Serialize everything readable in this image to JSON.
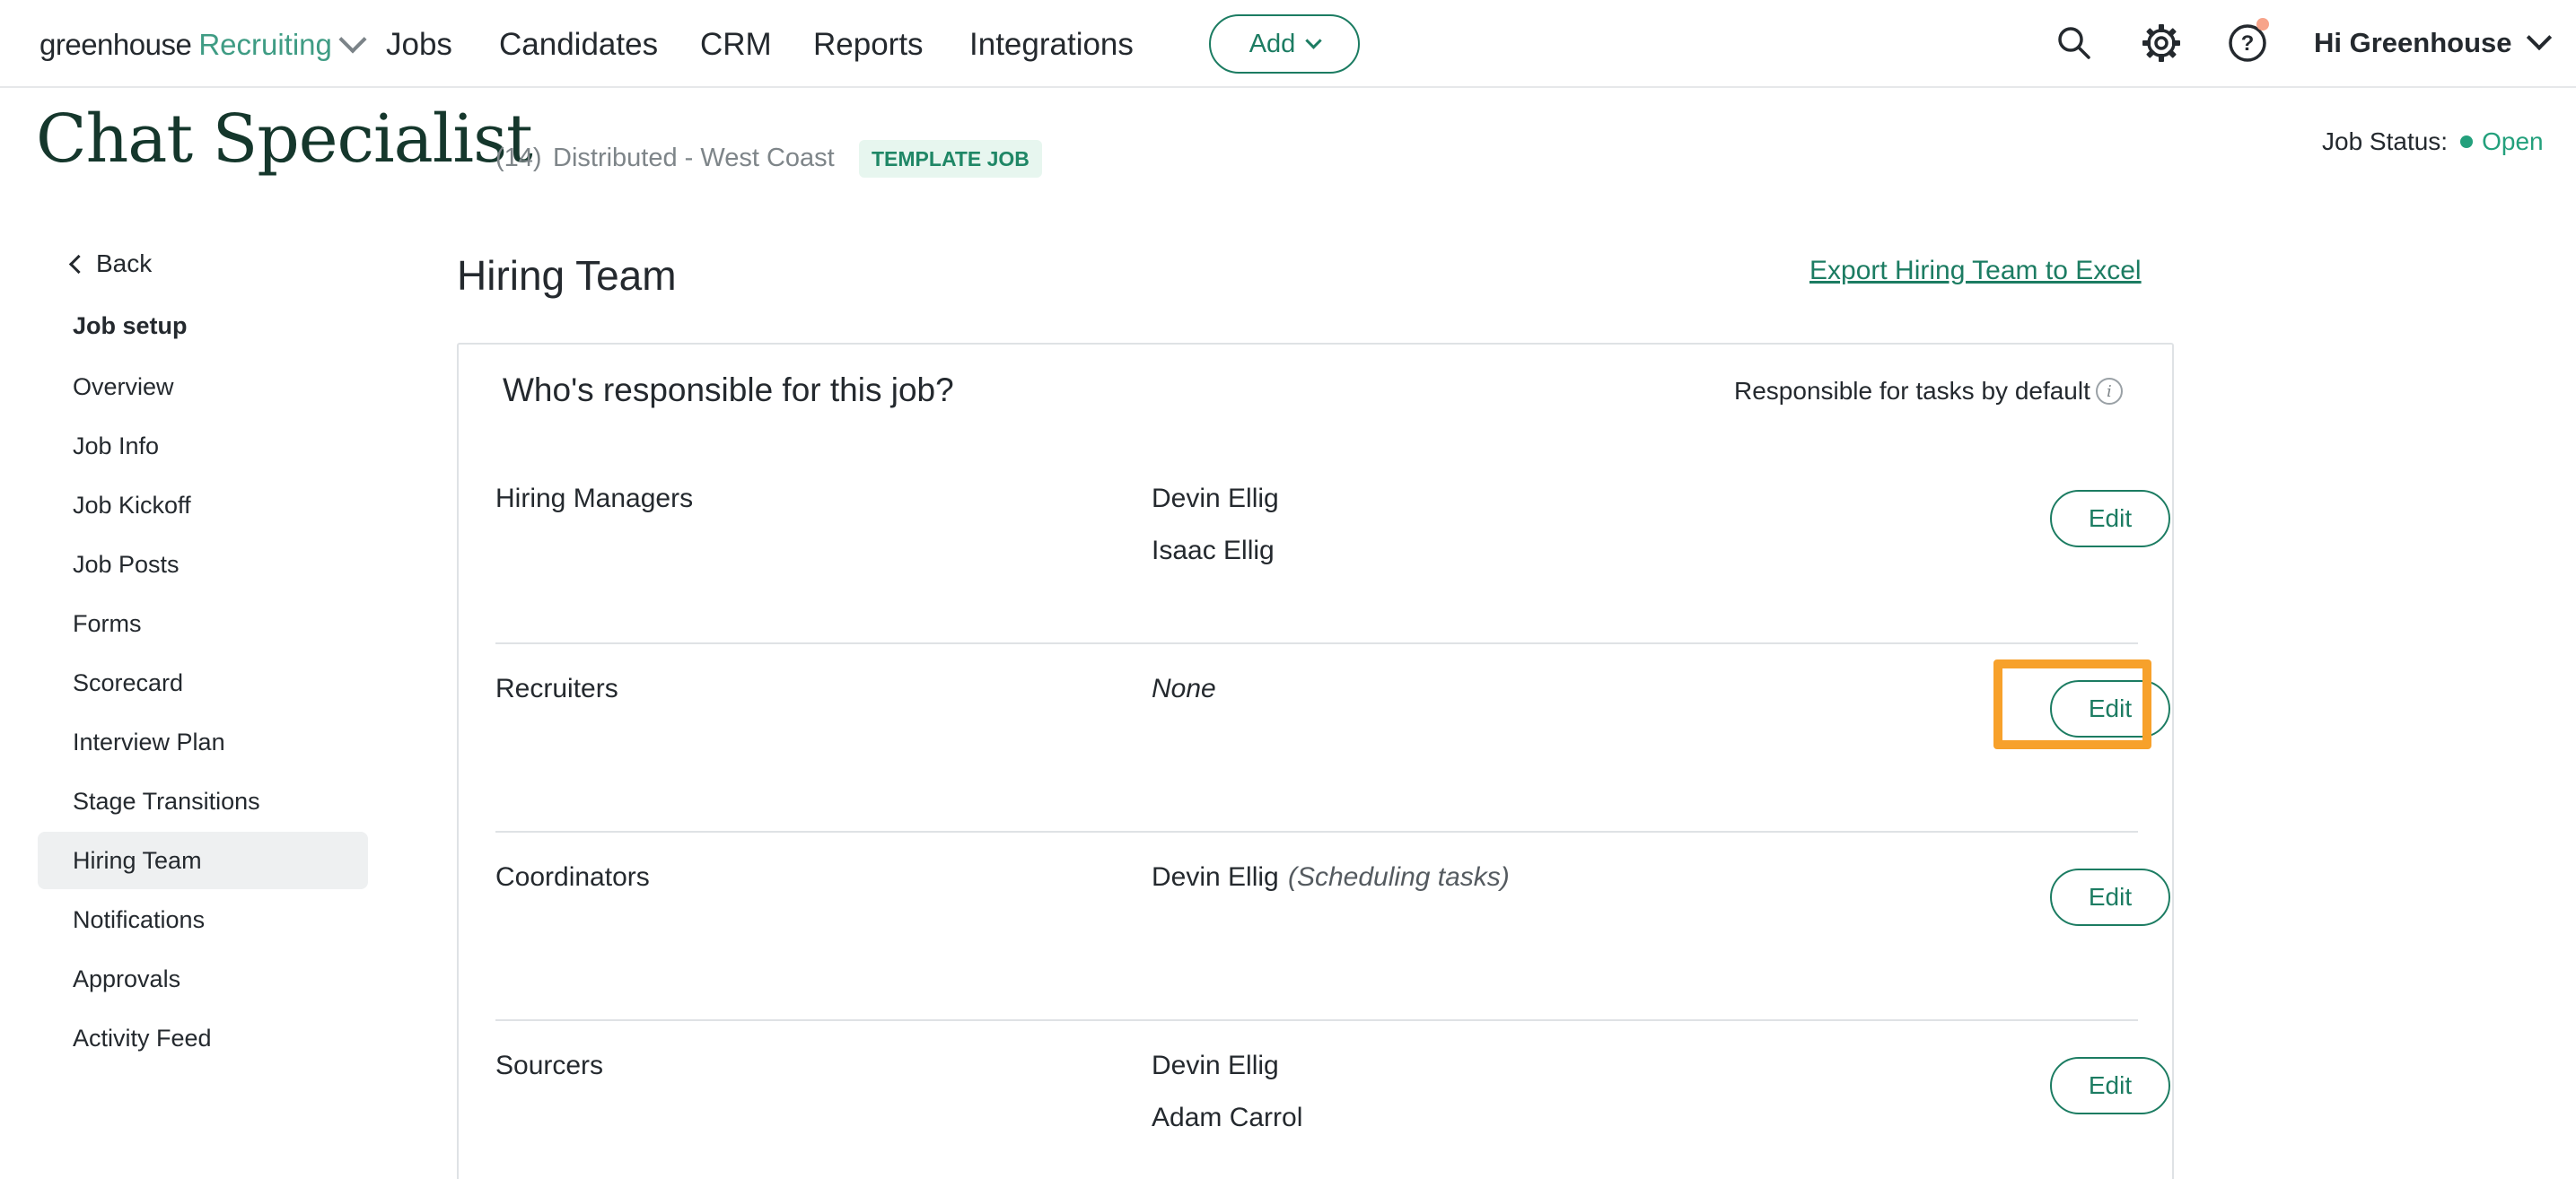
{
  "nav": {
    "brand_primary": "greenhouse",
    "brand_secondary": "Recruiting",
    "links": [
      "Jobs",
      "Candidates",
      "CRM",
      "Reports",
      "Integrations"
    ],
    "add_label": "Add",
    "greeting": "Hi Greenhouse",
    "icons": [
      "search-icon",
      "gear-icon",
      "help-icon",
      "chevron-down-icon"
    ]
  },
  "header": {
    "title": "Chat Specialist",
    "count": "(14)",
    "location": "Distributed - West Coast",
    "badge": "TEMPLATE JOB",
    "status_label": "Job Status:",
    "status_value": "Open"
  },
  "sidebar": {
    "back": "Back",
    "heading": "Job setup",
    "items": [
      {
        "label": "Overview"
      },
      {
        "label": "Job Info"
      },
      {
        "label": "Job Kickoff"
      },
      {
        "label": "Job Posts"
      },
      {
        "label": "Forms"
      },
      {
        "label": "Scorecard"
      },
      {
        "label": "Interview Plan"
      },
      {
        "label": "Stage Transitions"
      },
      {
        "label": "Hiring Team",
        "active": true
      },
      {
        "label": "Notifications"
      },
      {
        "label": "Approvals"
      },
      {
        "label": "Activity Feed"
      }
    ]
  },
  "main": {
    "title": "Hiring Team",
    "export_label": "Export Hiring Team to Excel",
    "question": "Who's responsible for this job?",
    "responsible_label": "Responsible for tasks by default",
    "edit_label": "Edit",
    "rows": [
      {
        "role": "Hiring Managers",
        "members": [
          "Devin Ellig",
          "Isaac Ellig"
        ]
      },
      {
        "role": "Recruiters",
        "members": [
          "None"
        ],
        "highlighted": true
      },
      {
        "role": "Coordinators",
        "members": [
          "Devin Ellig"
        ],
        "note": "(Scheduling tasks)"
      },
      {
        "role": "Sourcers",
        "members": [
          "Devin Ellig",
          "Adam Carrol"
        ]
      }
    ]
  },
  "colors": {
    "accent": "#1c7c62",
    "status_green": "#23a07c",
    "highlight": "#f7a12b",
    "title": "#15372c"
  }
}
